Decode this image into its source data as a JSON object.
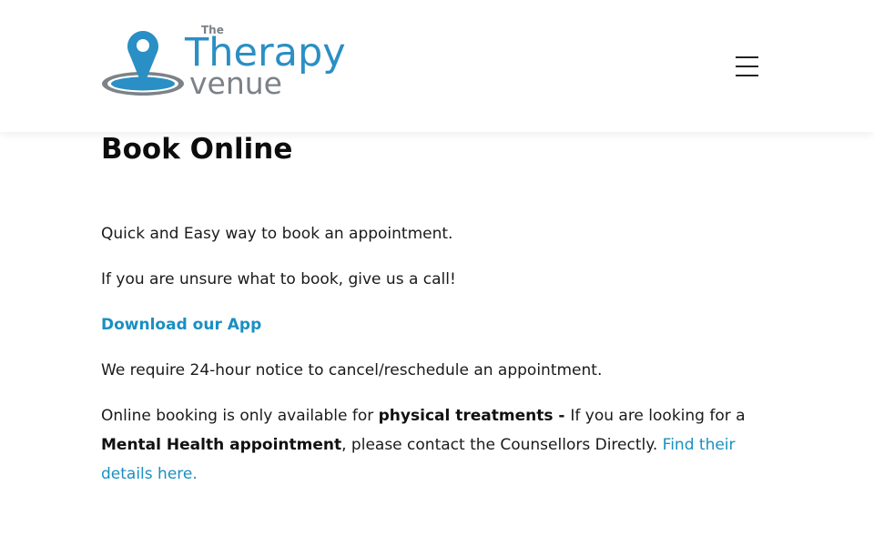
{
  "header": {
    "logo": {
      "small_text": "The",
      "line1": "Therapy",
      "line2": "venue",
      "colors": {
        "brand_blue": "#2a8fc4",
        "brand_gray": "#7b8288",
        "pin_light": "#4fb3e0"
      }
    },
    "menu_icon": "hamburger-menu-icon"
  },
  "main": {
    "title": "Book Online",
    "line1": "Quick and Easy way to book an appointment.",
    "line2": "If you are unsure what to book, give us a call!",
    "app_link": "Download our App",
    "line3": "We require 24-hour notice to cancel/reschedule an appointment.",
    "notice": {
      "intro": "Online booking is only available for ",
      "bold1": "physical treatments - ",
      "mid": "If you are looking for a ",
      "bold2": "Mental Health appointment",
      "after": ", please contact the Counsellors Directly.  ",
      "link": "Find their details here."
    }
  },
  "colors": {
    "link": "#1a8fc2",
    "text": "#1a1a1a",
    "title": "#0d0d0d"
  }
}
